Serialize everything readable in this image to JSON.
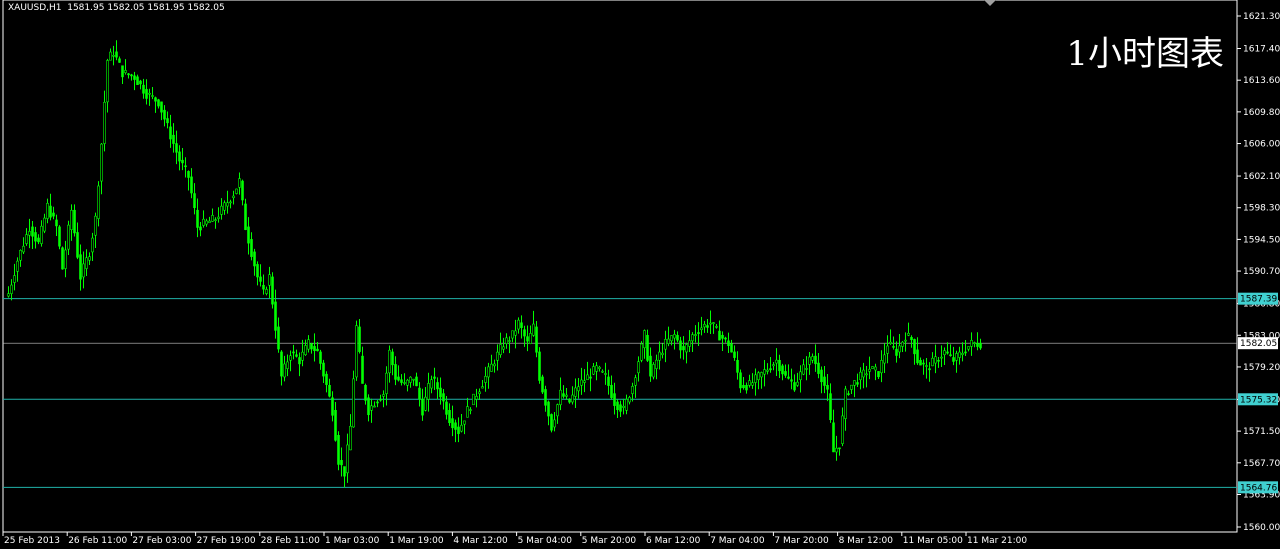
{
  "chart_data": {
    "type": "candlestick",
    "title": "XAUUSD,H1",
    "ohlc_text": "1581.95 1582.05 1581.95 1582.05",
    "annotation": "1小时图表",
    "colors": {
      "background": "#000000",
      "candles": "#00ff00",
      "axis": "#ffffff",
      "levels": "#20b2aa",
      "tag": "#40d0d0",
      "price_tag": "#ffffff"
    },
    "ylim": [
      1559.0,
      1623.0
    ],
    "y_ticks": [
      1621.3,
      1617.4,
      1613.6,
      1609.8,
      1606.0,
      1602.1,
      1598.3,
      1594.5,
      1590.7,
      1586.8,
      1583.0,
      1579.2,
      1575.3,
      1571.5,
      1567.7,
      1563.9,
      1560.0
    ],
    "y_tick_labels": [
      "1621.30",
      "1617.40",
      "1613.60",
      "1609.80",
      "1606.00",
      "1602.10",
      "1598.30",
      "1594.50",
      "1590.70",
      "1586.80",
      "1583.00",
      "1579.20",
      "1575.30",
      "1571.50",
      "1567.70",
      "1563.90",
      "1560.00"
    ],
    "x_labels": [
      "25 Feb 2013",
      "26 Feb 11:00",
      "27 Feb 03:00",
      "27 Feb 19:00",
      "28 Feb 11:00",
      "1 Mar 03:00",
      "1 Mar 19:00",
      "4 Mar 12:00",
      "5 Mar 04:00",
      "5 Mar 20:00",
      "6 Mar 12:00",
      "7 Mar 04:00",
      "7 Mar 20:00",
      "8 Mar 12:00",
      "11 Mar 05:00",
      "11 Mar 21:00"
    ],
    "levels": [
      {
        "label": "1587.39",
        "value": 1587.39
      },
      {
        "label": "1575.32",
        "value": 1575.32
      },
      {
        "label": "1564.76",
        "value": 1564.76
      }
    ],
    "current_price": {
      "label": "1582.05",
      "value": 1582.05
    },
    "close_path": [
      [
        0,
        1588.0
      ],
      [
        3,
        1592.0
      ],
      [
        7,
        1596.0
      ],
      [
        10,
        1594.0
      ],
      [
        13,
        1598.5
      ],
      [
        16,
        1596.0
      ],
      [
        18,
        1591.0
      ],
      [
        21,
        1598.0
      ],
      [
        24,
        1590.0
      ],
      [
        27,
        1593.0
      ],
      [
        29,
        1597.0
      ],
      [
        31,
        1606.0
      ],
      [
        33,
        1616.0
      ],
      [
        35,
        1617.0
      ],
      [
        38,
        1614.5
      ],
      [
        42,
        1614.0
      ],
      [
        46,
        1612.0
      ],
      [
        50,
        1611.0
      ],
      [
        54,
        1607.0
      ],
      [
        57,
        1604.0
      ],
      [
        60,
        1602.0
      ],
      [
        63,
        1596.0
      ],
      [
        66,
        1596.5
      ],
      [
        69,
        1597.0
      ],
      [
        72,
        1598.5
      ],
      [
        75,
        1600.0
      ],
      [
        77,
        1601.5
      ],
      [
        79,
        1596.0
      ],
      [
        81,
        1593.0
      ],
      [
        83,
        1590.0
      ],
      [
        85,
        1588.0
      ],
      [
        87,
        1590.0
      ],
      [
        89,
        1584.0
      ],
      [
        91,
        1578.0
      ],
      [
        94,
        1581.0
      ],
      [
        97,
        1580.0
      ],
      [
        100,
        1582.0
      ],
      [
        103,
        1581.0
      ],
      [
        106,
        1577.0
      ],
      [
        108,
        1574.0
      ],
      [
        110,
        1568.0
      ],
      [
        112,
        1566.5
      ],
      [
        114,
        1572.0
      ],
      [
        116,
        1584.0
      ],
      [
        118,
        1577.0
      ],
      [
        120,
        1574.0
      ],
      [
        122,
        1575.0
      ],
      [
        125,
        1576.0
      ],
      [
        127,
        1581.0
      ],
      [
        129,
        1578.0
      ],
      [
        132,
        1577.0
      ],
      [
        135,
        1578.0
      ],
      [
        138,
        1574.0
      ],
      [
        141,
        1578.0
      ],
      [
        144,
        1576.0
      ],
      [
        147,
        1573.0
      ],
      [
        150,
        1571.5
      ],
      [
        153,
        1574.0
      ],
      [
        156,
        1576.0
      ],
      [
        159,
        1578.0
      ],
      [
        162,
        1580.0
      ],
      [
        165,
        1582.0
      ],
      [
        168,
        1583.0
      ],
      [
        170,
        1584.5
      ],
      [
        173,
        1582.0
      ],
      [
        175,
        1584.0
      ],
      [
        177,
        1578.0
      ],
      [
        179,
        1575.0
      ],
      [
        181,
        1572.0
      ],
      [
        184,
        1576.0
      ],
      [
        187,
        1575.0
      ],
      [
        190,
        1577.0
      ],
      [
        193,
        1578.0
      ],
      [
        196,
        1579.0
      ],
      [
        199,
        1578.0
      ],
      [
        202,
        1575.0
      ],
      [
        205,
        1574.0
      ],
      [
        208,
        1577.0
      ],
      [
        210,
        1580.0
      ],
      [
        212,
        1583.0
      ],
      [
        214,
        1578.0
      ],
      [
        216,
        1580.0
      ],
      [
        219,
        1582.0
      ],
      [
        222,
        1583.0
      ],
      [
        225,
        1581.0
      ],
      [
        228,
        1583.0
      ],
      [
        231,
        1584.0
      ],
      [
        234,
        1584.5
      ],
      [
        237,
        1583.0
      ],
      [
        240,
        1582.0
      ],
      [
        242,
        1580.0
      ],
      [
        244,
        1577.0
      ],
      [
        247,
        1577.0
      ],
      [
        250,
        1578.0
      ],
      [
        253,
        1579.0
      ],
      [
        256,
        1580.0
      ],
      [
        259,
        1578.0
      ],
      [
        262,
        1577.0
      ],
      [
        265,
        1579.0
      ],
      [
        268,
        1580.5
      ],
      [
        271,
        1578.0
      ],
      [
        273,
        1576.0
      ],
      [
        275,
        1569.0
      ],
      [
        277,
        1570.0
      ],
      [
        279,
        1576.0
      ],
      [
        281,
        1577.0
      ],
      [
        284,
        1578.0
      ],
      [
        287,
        1579.0
      ],
      [
        290,
        1578.5
      ],
      [
        293,
        1582.0
      ],
      [
        296,
        1581.0
      ],
      [
        299,
        1583.0
      ],
      [
        301,
        1582.5
      ],
      [
        303,
        1580.0
      ],
      [
        306,
        1579.0
      ],
      [
        309,
        1580.0
      ],
      [
        312,
        1581.0
      ],
      [
        315,
        1580.0
      ],
      [
        318,
        1581.0
      ],
      [
        321,
        1582.0
      ],
      [
        324,
        1582.05
      ]
    ]
  }
}
